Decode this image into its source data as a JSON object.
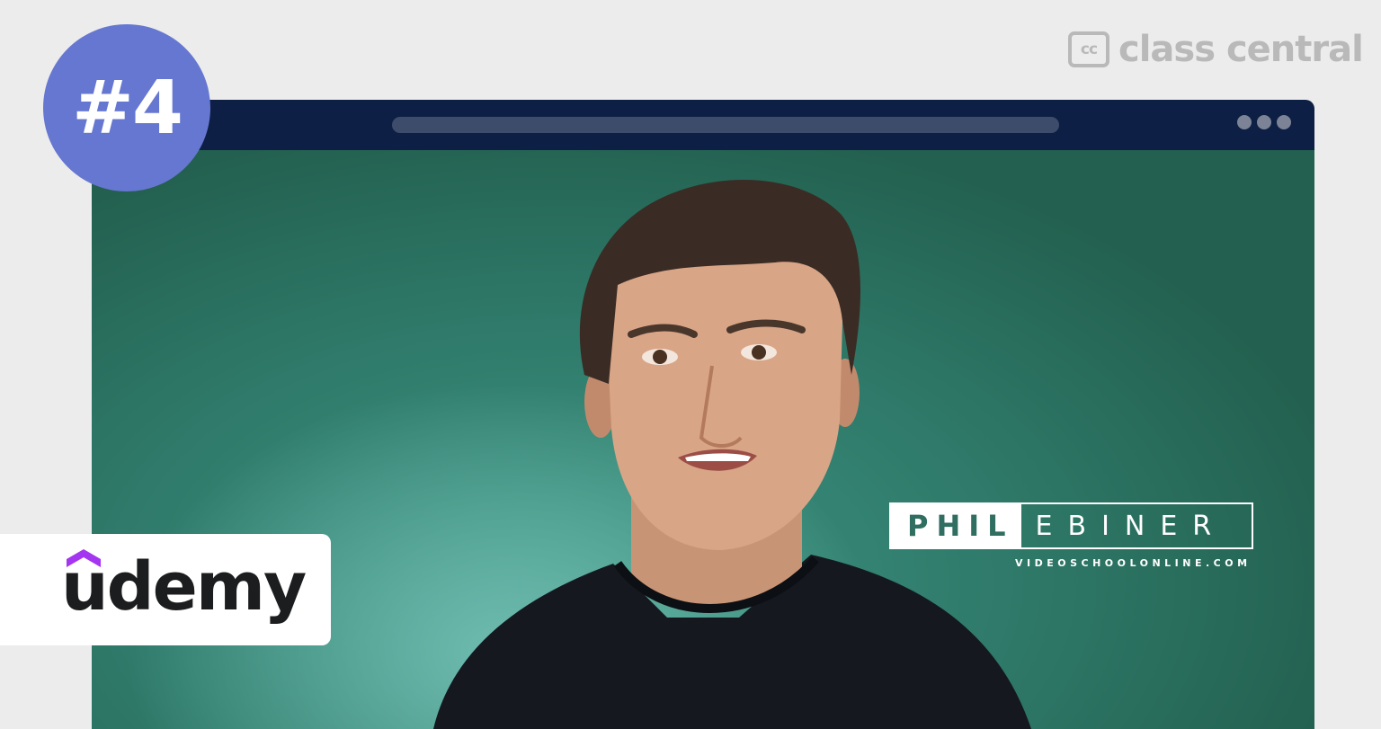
{
  "rank": {
    "label": "#4"
  },
  "brand": {
    "cc_mark": "cc",
    "name": "class central"
  },
  "video": {
    "presenter_first": "PHIL",
    "presenter_last": "EBINER",
    "website": "VIDEOSCHOOLONLINE.COM"
  },
  "provider": {
    "name": "udemy"
  },
  "colors": {
    "badge": "#6677d1",
    "titlebar": "#0d1f44",
    "video_bg": "#3f9583",
    "udemy_purple": "#a435f0"
  }
}
